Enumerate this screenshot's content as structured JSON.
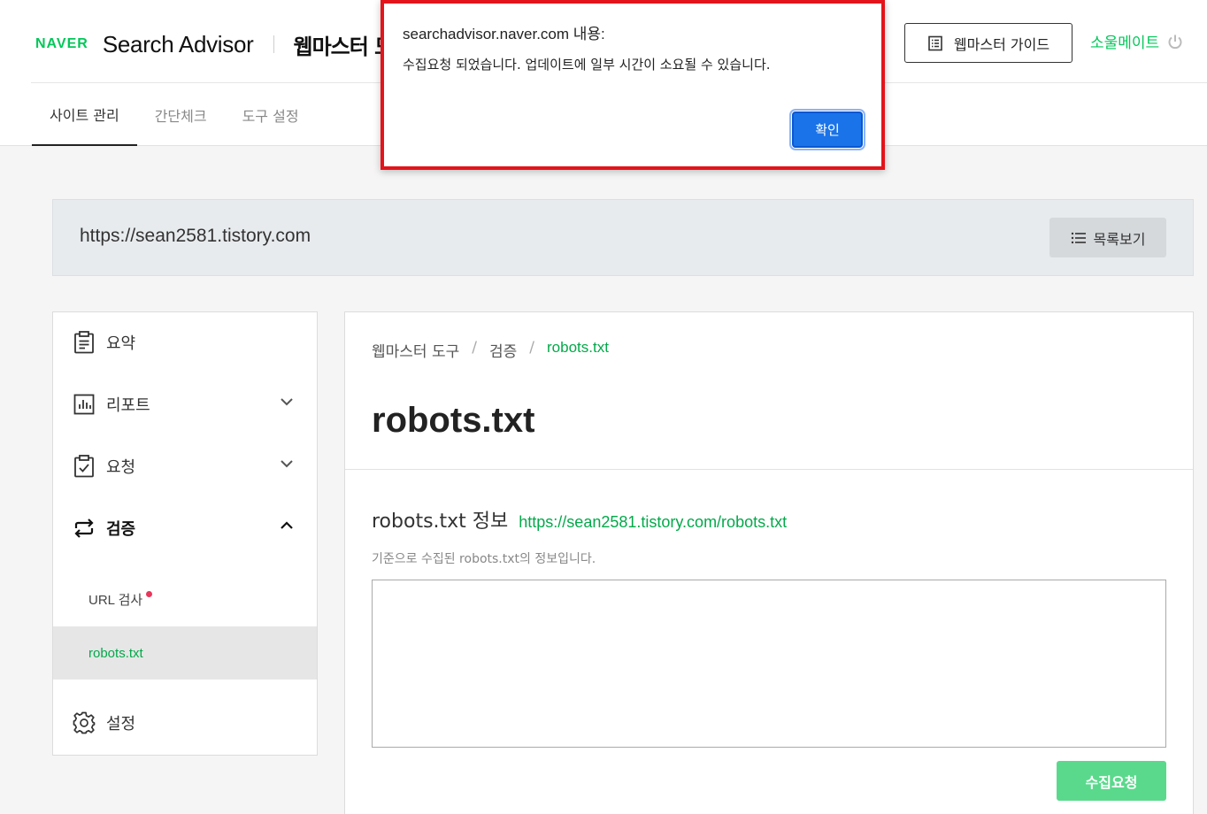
{
  "header": {
    "logo": "NAVER",
    "app_title": "Search Advisor",
    "subtitle": "웹마스터 도구",
    "guide_button": "웹마스터 가이드",
    "user_name": "소울메이트"
  },
  "tabs": [
    {
      "label": "사이트 관리",
      "active": true
    },
    {
      "label": "간단체크",
      "active": false
    },
    {
      "label": "도구 설정",
      "active": false
    }
  ],
  "site": {
    "url": "https://sean2581.tistory.com",
    "list_button": "목록보기"
  },
  "sidebar": {
    "items": [
      {
        "label": "요약",
        "icon": "clipboard-icon"
      },
      {
        "label": "리포트",
        "icon": "chart-icon",
        "expanded": false
      },
      {
        "label": "요청",
        "icon": "clipboard-check-icon",
        "expanded": false
      },
      {
        "label": "검증",
        "icon": "repeat-icon",
        "expanded": true
      },
      {
        "label": "설정",
        "icon": "gear-icon"
      }
    ],
    "subitems": [
      {
        "label": "URL 검사",
        "badge": true
      },
      {
        "label": "robots.txt",
        "active": true
      }
    ]
  },
  "main": {
    "breadcrumb": [
      "웹마스터 도구",
      "검증",
      "robots.txt"
    ],
    "title": "robots.txt",
    "section_title": "robots.txt 정보",
    "section_link": "https://sean2581.tistory.com/robots.txt",
    "description": "기준으로 수집된 robots.txt의 정보입니다.",
    "textarea_value": "",
    "collect_button": "수집요청"
  },
  "dialog": {
    "origin": "searchadvisor.naver.com 내용:",
    "message": "수집요청 되었습니다. 업데이트에 일부 시간이 소요될 수 있습니다.",
    "ok_button": "확인"
  },
  "colors": {
    "brand_green": "#03c75a",
    "link_green": "#03a94a",
    "highlight_red": "#e3141b",
    "dialog_blue": "#1a73e8"
  }
}
